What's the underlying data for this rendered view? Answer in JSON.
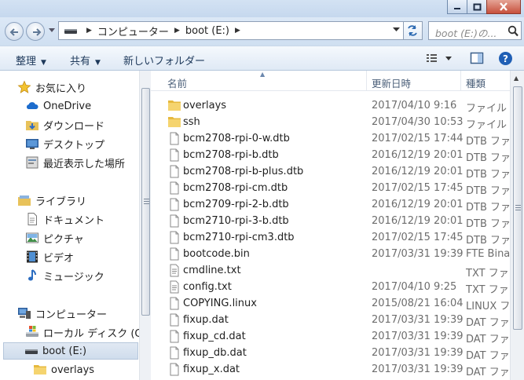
{
  "window": {
    "controls": [
      {
        "name": "minimize-button",
        "icon": "minimize-icon"
      },
      {
        "name": "maximize-button",
        "icon": "maximize-icon"
      },
      {
        "name": "close-button",
        "icon": "close-icon"
      }
    ]
  },
  "address_bar": {
    "segments": [
      "コンピューター",
      "boot (E:)"
    ],
    "search_placeholder": "boot (E:)の..."
  },
  "toolbar": {
    "organize_label": "整理",
    "share_label": "共有",
    "new_folder_label": "新しいフォルダー"
  },
  "nav": {
    "favorites_label": "お気に入り",
    "favorites": [
      "OneDrive",
      "ダウンロード",
      "デスクトップ",
      "最近表示した場所"
    ],
    "libraries_label": "ライブラリ",
    "libraries": [
      "ドキュメント",
      "ピクチャ",
      "ビデオ",
      "ミュージック"
    ],
    "computer_label": "コンピューター",
    "drives": [
      "ローカル ディスク (C:",
      "boot (E:)"
    ],
    "subfolders": [
      "overlays"
    ]
  },
  "columns": {
    "name": "名前",
    "date": "更新日時",
    "type": "種類"
  },
  "files": [
    {
      "name": "overlays",
      "date": "2017/04/10 9:16",
      "type": "ファイル フ",
      "kind": "folder"
    },
    {
      "name": "ssh",
      "date": "2017/04/30 10:53",
      "type": "ファイル フ",
      "kind": "folder"
    },
    {
      "name": "bcm2708-rpi-0-w.dtb",
      "date": "2017/02/15 17:44",
      "type": "DTB ファ",
      "kind": "file"
    },
    {
      "name": "bcm2708-rpi-b.dtb",
      "date": "2016/12/19 20:01",
      "type": "DTB ファ",
      "kind": "file"
    },
    {
      "name": "bcm2708-rpi-b-plus.dtb",
      "date": "2016/12/19 20:01",
      "type": "DTB ファ",
      "kind": "file"
    },
    {
      "name": "bcm2708-rpi-cm.dtb",
      "date": "2017/02/15 17:45",
      "type": "DTB ファ",
      "kind": "file"
    },
    {
      "name": "bcm2709-rpi-2-b.dtb",
      "date": "2016/12/19 20:01",
      "type": "DTB ファ",
      "kind": "file"
    },
    {
      "name": "bcm2710-rpi-3-b.dtb",
      "date": "2016/12/19 20:01",
      "type": "DTB ファ",
      "kind": "file"
    },
    {
      "name": "bcm2710-rpi-cm3.dtb",
      "date": "2017/02/15 17:45",
      "type": "DTB ファ",
      "kind": "file"
    },
    {
      "name": "bootcode.bin",
      "date": "2017/03/31 19:39",
      "type": "FTE Binar",
      "kind": "file"
    },
    {
      "name": "cmdline.txt",
      "date": "",
      "type": "TXT ファ",
      "kind": "text"
    },
    {
      "name": "config.txt",
      "date": "2017/04/10 9:25",
      "type": "TXT ファ",
      "kind": "text"
    },
    {
      "name": "COPYING.linux",
      "date": "2015/08/21 16:04",
      "type": "LINUX フ",
      "kind": "file"
    },
    {
      "name": "fixup.dat",
      "date": "2017/03/31 19:39",
      "type": "DAT ファ",
      "kind": "file"
    },
    {
      "name": "fixup_cd.dat",
      "date": "2017/03/31 19:39",
      "type": "DAT ファ",
      "kind": "file"
    },
    {
      "name": "fixup_db.dat",
      "date": "2017/03/31 19:39",
      "type": "DAT ファ",
      "kind": "file"
    },
    {
      "name": "fixup_x.dat",
      "date": "2017/03/31 19:39",
      "type": "DAT ファ",
      "kind": "file"
    }
  ]
}
